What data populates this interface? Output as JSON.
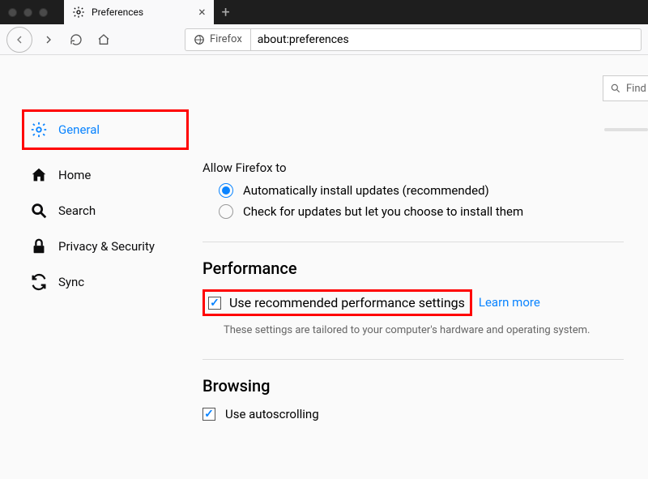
{
  "window": {
    "tab_title": "Preferences",
    "identity_label": "Firefox",
    "url": "about:preferences",
    "find_placeholder": "Find"
  },
  "sidebar": {
    "items": [
      {
        "key": "general",
        "label": "General",
        "active": true
      },
      {
        "key": "home",
        "label": "Home"
      },
      {
        "key": "search",
        "label": "Search"
      },
      {
        "key": "privacy",
        "label": "Privacy & Security"
      },
      {
        "key": "sync",
        "label": "Sync"
      }
    ]
  },
  "updates": {
    "allow_label": "Allow Firefox to",
    "auto_label": "Automatically install updates (recommended)",
    "check_label": "Check for updates but let you choose to install them",
    "selected": "auto"
  },
  "performance": {
    "heading": "Performance",
    "use_recommended_label": "Use recommended performance settings",
    "use_recommended_checked": true,
    "learn_more": "Learn more",
    "description": "These settings are tailored to your computer's hardware and operating system."
  },
  "browsing": {
    "heading": "Browsing",
    "autoscroll_label": "Use autoscrolling",
    "autoscroll_checked": true
  }
}
